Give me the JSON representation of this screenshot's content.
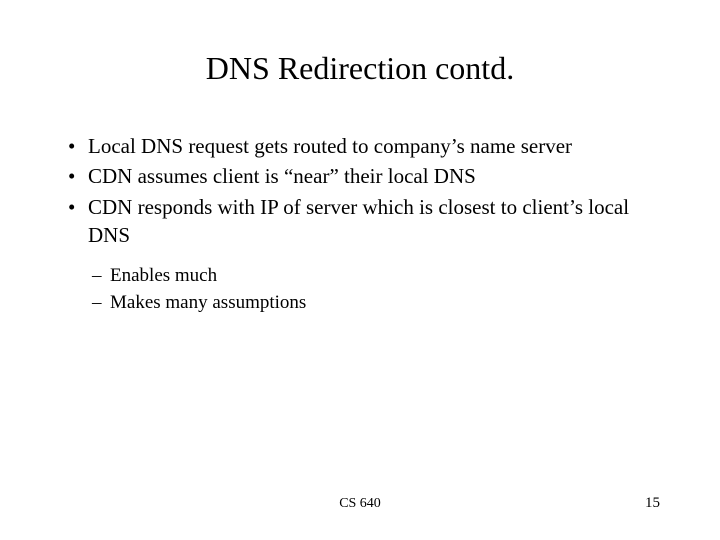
{
  "title": "DNS Redirection contd.",
  "bullets": [
    "Local DNS request gets routed to company’s name server",
    "CDN assumes client is “near” their local DNS",
    "CDN responds with IP of server which is closest to client’s local DNS"
  ],
  "subbullets": [
    "Enables much",
    "Makes many assumptions"
  ],
  "footer": {
    "center": "CS 640",
    "page": "15"
  }
}
